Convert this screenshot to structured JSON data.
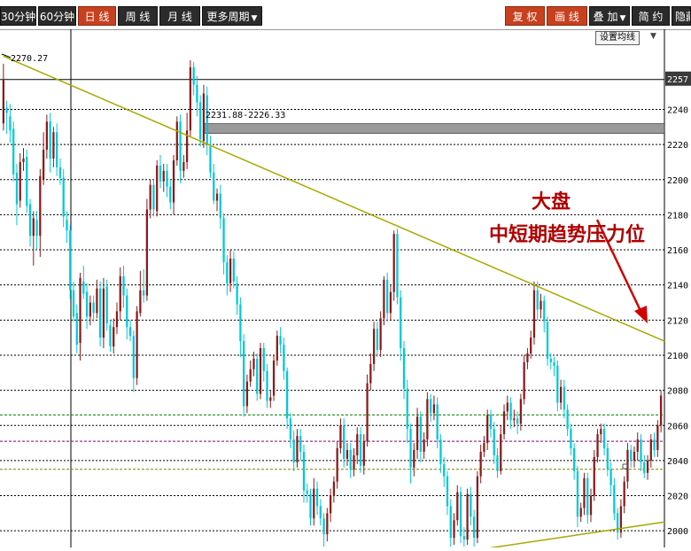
{
  "toolbar": {
    "period_tabs": [
      "30分钟",
      "60分钟",
      "日 线",
      "周 线",
      "月 线"
    ],
    "more_periods": "更多周期",
    "restore_rights": "复 权",
    "draw_line": "画 线",
    "overlay": "叠 加",
    "simple": "简 约",
    "hide": "隐藏"
  },
  "settings_button": "设置均线",
  "annotation": {
    "line1": "大盘",
    "line2": "中短期趋势压力位"
  },
  "labels": {
    "high_marker": "2270.27",
    "band_label": "2231.88-2226.33",
    "current_price_tag": "2257"
  },
  "colors": {
    "up_candle": "#8b1a1a",
    "down_candle": "#00c8d8",
    "trendline": "#a8a800",
    "annotation": "#b00000",
    "active_tab": "#c8401e"
  },
  "chart_data": {
    "type": "candlestick",
    "ylim": [
      1990,
      2270
    ],
    "y_ticks": [
      2000,
      2020,
      2040,
      2060,
      2080,
      2100,
      2120,
      2140,
      2160,
      2180,
      2200,
      2220,
      2240
    ],
    "y_tick_labels": [
      "2000",
      "2020",
      "2040",
      "2060",
      "2080",
      "2100",
      "2120",
      "2140",
      "2160",
      "2180",
      "2200",
      "2220",
      "2240"
    ],
    "horizontal_lines": [
      {
        "value": 2257,
        "color": "#000000",
        "style": "solid"
      },
      {
        "value": 2231.88,
        "color": "#808080",
        "style": "band",
        "to": 2226.33
      },
      {
        "value": 2066,
        "color": "#008000",
        "style": "dashed"
      },
      {
        "value": 2051,
        "color": "#800080",
        "style": "dashed"
      },
      {
        "value": 2035,
        "color": "#808000",
        "style": "dashed"
      }
    ],
    "resistance_trendline": {
      "from": [
        0,
        2270.27
      ],
      "to": [
        199,
        2108
      ]
    },
    "support_trendline": {
      "from": [
        145,
        1990
      ],
      "to": [
        199,
        2005
      ]
    },
    "candles": [
      [
        2232,
        2257,
        2266,
        2228
      ],
      [
        2241,
        2238,
        2245,
        2226
      ],
      [
        2236,
        2228,
        2243,
        2221
      ],
      [
        2229,
        2203,
        2233,
        2199
      ],
      [
        2204,
        2186,
        2209,
        2174
      ],
      [
        2188,
        2210,
        2215,
        2184
      ],
      [
        2210,
        2212,
        2218,
        2205
      ],
      [
        2213,
        2185,
        2217,
        2181
      ],
      [
        2186,
        2168,
        2189,
        2162
      ],
      [
        2168,
        2178,
        2182,
        2151
      ],
      [
        2177,
        2168,
        2182,
        2160
      ],
      [
        2168,
        2202,
        2206,
        2156
      ],
      [
        2200,
        2217,
        2227,
        2197
      ],
      [
        2217,
        2233,
        2237,
        2212
      ],
      [
        2233,
        2212,
        2238,
        2204
      ],
      [
        2212,
        2227,
        2230,
        2207
      ],
      [
        2227,
        2207,
        2232,
        2202
      ],
      [
        2207,
        2201,
        2212,
        2197
      ],
      [
        2201,
        2179,
        2206,
        2173
      ],
      [
        2177,
        2171,
        2182,
        2164
      ],
      [
        2171,
        2137,
        2174,
        2132
      ],
      [
        2137,
        2122,
        2142,
        2119
      ],
      [
        2124,
        2106,
        2129,
        2101
      ],
      [
        2107,
        2144,
        2147,
        2097
      ],
      [
        2142,
        2135,
        2151,
        2132
      ],
      [
        2136,
        2122,
        2141,
        2115
      ],
      [
        2122,
        2130,
        2134,
        2117
      ],
      [
        2130,
        2124,
        2134,
        2119
      ],
      [
        2124,
        2138,
        2143,
        2121
      ],
      [
        2138,
        2110,
        2142,
        2105
      ],
      [
        2110,
        2138,
        2144,
        2104
      ],
      [
        2139,
        2118,
        2143,
        2114
      ],
      [
        2117,
        2105,
        2120,
        2102
      ],
      [
        2105,
        2116,
        2121,
        2101
      ],
      [
        2116,
        2125,
        2130,
        2112
      ],
      [
        2125,
        2145,
        2150,
        2120
      ],
      [
        2145,
        2134,
        2151,
        2127
      ],
      [
        2134,
        2116,
        2138,
        2109
      ],
      [
        2116,
        2111,
        2120,
        2108
      ],
      [
        2111,
        2087,
        2114,
        2079
      ],
      [
        2087,
        2125,
        2128,
        2083
      ],
      [
        2124,
        2137,
        2148,
        2122
      ],
      [
        2137,
        2134,
        2149,
        2130
      ],
      [
        2134,
        2183,
        2189,
        2131
      ],
      [
        2183,
        2197,
        2200,
        2178
      ],
      [
        2197,
        2183,
        2200,
        2179
      ],
      [
        2182,
        2208,
        2211,
        2179
      ],
      [
        2208,
        2199,
        2214,
        2195
      ],
      [
        2199,
        2205,
        2209,
        2193
      ],
      [
        2205,
        2196,
        2209,
        2190
      ],
      [
        2196,
        2187,
        2200,
        2183
      ],
      [
        2187,
        2211,
        2214,
        2180
      ],
      [
        2211,
        2233,
        2236,
        2208
      ],
      [
        2233,
        2205,
        2237,
        2198
      ],
      [
        2205,
        2210,
        2214,
        2201
      ],
      [
        2210,
        2228,
        2238,
        2206
      ],
      [
        2228,
        2264,
        2268,
        2224
      ],
      [
        2264,
        2254,
        2267,
        2248
      ],
      [
        2254,
        2244,
        2259,
        2236
      ],
      [
        2244,
        2223,
        2248,
        2219
      ],
      [
        2222,
        2249,
        2254,
        2218
      ],
      [
        2248,
        2220,
        2253,
        2214
      ],
      [
        2219,
        2204,
        2225,
        2201
      ],
      [
        2204,
        2188,
        2209,
        2186
      ],
      [
        2188,
        2192,
        2195,
        2182
      ],
      [
        2192,
        2178,
        2197,
        2172
      ],
      [
        2178,
        2153,
        2181,
        2146
      ],
      [
        2153,
        2141,
        2157,
        2134
      ],
      [
        2141,
        2155,
        2160,
        2136
      ],
      [
        2155,
        2142,
        2159,
        2138
      ],
      [
        2141,
        2129,
        2145,
        2123
      ],
      [
        2129,
        2108,
        2133,
        2099
      ],
      [
        2108,
        2071,
        2112,
        2065
      ],
      [
        2071,
        2085,
        2089,
        2067
      ],
      [
        2085,
        2092,
        2097,
        2082
      ],
      [
        2092,
        2098,
        2102,
        2088
      ],
      [
        2098,
        2078,
        2101,
        2074
      ],
      [
        2078,
        2104,
        2107,
        2075
      ],
      [
        2104,
        2091,
        2107,
        2085
      ],
      [
        2091,
        2074,
        2095,
        2070
      ],
      [
        2074,
        2076,
        2080,
        2070
      ],
      [
        2077,
        2097,
        2100,
        2074
      ],
      [
        2097,
        2111,
        2114,
        2094
      ],
      [
        2111,
        2106,
        2116,
        2101
      ],
      [
        2106,
        2091,
        2110,
        2086
      ],
      [
        2091,
        2064,
        2093,
        2058
      ],
      [
        2064,
        2052,
        2067,
        2047
      ],
      [
        2052,
        2039,
        2057,
        2034
      ],
      [
        2039,
        2054,
        2058,
        2036
      ],
      [
        2054,
        2045,
        2058,
        2040
      ],
      [
        2045,
        2023,
        2049,
        2016
      ],
      [
        2023,
        2021,
        2027,
        2016
      ],
      [
        2021,
        2007,
        2024,
        2003
      ],
      [
        2007,
        2024,
        2030,
        2003
      ],
      [
        2024,
        2014,
        2028,
        2009
      ],
      [
        2014,
        2007,
        2018,
        2003
      ],
      [
        2007,
        1998,
        2010,
        1991
      ],
      [
        1998,
        2010,
        2013,
        1994
      ],
      [
        2010,
        2020,
        2024,
        2005
      ],
      [
        2020,
        2028,
        2031,
        2016
      ],
      [
        2028,
        2047,
        2051,
        2024
      ],
      [
        2047,
        2060,
        2064,
        2044
      ],
      [
        2060,
        2041,
        2064,
        2036
      ],
      [
        2041,
        2046,
        2050,
        2037
      ],
      [
        2046,
        2035,
        2050,
        2030
      ],
      [
        2035,
        2043,
        2047,
        2031
      ],
      [
        2043,
        2055,
        2059,
        2038
      ],
      [
        2055,
        2037,
        2059,
        2033
      ],
      [
        2037,
        2051,
        2055,
        2032
      ],
      [
        2051,
        2084,
        2089,
        2048
      ],
      [
        2084,
        2095,
        2101,
        2080
      ],
      [
        2095,
        2115,
        2119,
        2091
      ],
      [
        2115,
        2103,
        2119,
        2099
      ],
      [
        2103,
        2121,
        2125,
        2099
      ],
      [
        2121,
        2143,
        2145,
        2117
      ],
      [
        2143,
        2124,
        2147,
        2119
      ],
      [
        2124,
        2136,
        2140,
        2120
      ],
      [
        2136,
        2169,
        2171,
        2131
      ],
      [
        2169,
        2133,
        2172,
        2129
      ],
      [
        2133,
        2104,
        2137,
        2097
      ],
      [
        2104,
        2081,
        2108,
        2075
      ],
      [
        2081,
        2058,
        2086,
        2050
      ],
      [
        2058,
        2036,
        2061,
        2027
      ],
      [
        2036,
        2046,
        2050,
        2031
      ],
      [
        2046,
        2065,
        2070,
        2041
      ],
      [
        2065,
        2045,
        2068,
        2039
      ],
      [
        2045,
        2052,
        2056,
        2041
      ],
      [
        2052,
        2075,
        2079,
        2048
      ],
      [
        2075,
        2067,
        2078,
        2062
      ],
      [
        2067,
        2072,
        2077,
        2063
      ],
      [
        2072,
        2052,
        2076,
        2047
      ],
      [
        2052,
        2038,
        2055,
        2033
      ],
      [
        2038,
        2031,
        2042,
        2025
      ],
      [
        2031,
        2014,
        2034,
        2009
      ],
      [
        2014,
        1996,
        2018,
        1991
      ],
      [
        1996,
        2006,
        2010,
        1992
      ],
      [
        2006,
        2022,
        2026,
        2003
      ],
      [
        2022,
        1997,
        2025,
        1993
      ],
      [
        1997,
        1995,
        2002,
        1991
      ],
      [
        1995,
        2021,
        2024,
        1992
      ],
      [
        2021,
        2008,
        2025,
        2003
      ],
      [
        2008,
        1996,
        2012,
        1991
      ],
      [
        1996,
        2031,
        2034,
        1993
      ],
      [
        2031,
        2045,
        2049,
        2027
      ],
      [
        2045,
        2050,
        2054,
        2042
      ],
      [
        2050,
        2066,
        2069,
        2046
      ],
      [
        2066,
        2058,
        2069,
        2053
      ],
      [
        2058,
        2043,
        2062,
        2038
      ],
      [
        2043,
        2034,
        2047,
        2030
      ],
      [
        2034,
        2055,
        2060,
        2032
      ],
      [
        2055,
        2068,
        2072,
        2052
      ],
      [
        2068,
        2073,
        2077,
        2063
      ],
      [
        2073,
        2063,
        2076,
        2058
      ],
      [
        2063,
        2064,
        2069,
        2059
      ],
      [
        2064,
        2061,
        2068,
        2055
      ],
      [
        2061,
        2075,
        2078,
        2057
      ],
      [
        2075,
        2096,
        2100,
        2072
      ],
      [
        2096,
        2101,
        2104,
        2092
      ],
      [
        2101,
        2110,
        2114,
        2098
      ],
      [
        2110,
        2137,
        2142,
        2106
      ],
      [
        2137,
        2126,
        2142,
        2120
      ],
      [
        2126,
        2131,
        2135,
        2121
      ],
      [
        2131,
        2119,
        2134,
        2113
      ],
      [
        2119,
        2098,
        2122,
        2094
      ],
      [
        2098,
        2096,
        2101,
        2092
      ],
      [
        2096,
        2094,
        2099,
        2088
      ],
      [
        2094,
        2073,
        2097,
        2068
      ],
      [
        2073,
        2082,
        2086,
        2069
      ],
      [
        2082,
        2069,
        2086,
        2064
      ],
      [
        2069,
        2058,
        2072,
        2054
      ],
      [
        2058,
        2047,
        2061,
        2043
      ],
      [
        2047,
        2034,
        2050,
        2029
      ],
      [
        2034,
        2008,
        2037,
        2002
      ],
      [
        2008,
        2013,
        2016,
        2005
      ],
      [
        2013,
        2030,
        2033,
        2009
      ],
      [
        2030,
        2009,
        2033,
        2004
      ],
      [
        2009,
        2020,
        2024,
        2005
      ],
      [
        2020,
        2042,
        2046,
        2017
      ],
      [
        2042,
        2055,
        2058,
        2039
      ],
      [
        2055,
        2058,
        2061,
        2050
      ],
      [
        2058,
        2047,
        2061,
        2043
      ],
      [
        2047,
        2035,
        2050,
        2031
      ],
      [
        2035,
        2026,
        2039,
        2020
      ],
      [
        2026,
        2010,
        2030,
        2006
      ],
      [
        2010,
        1999,
        2013,
        1995
      ],
      [
        1999,
        2014,
        2018,
        1996
      ],
      [
        2014,
        2028,
        2031,
        2010
      ],
      [
        2028,
        2046,
        2050,
        2024
      ],
      [
        2046,
        2040,
        2049,
        2036
      ],
      [
        2040,
        2045,
        2048,
        2036
      ],
      [
        2045,
        2052,
        2056,
        2040
      ],
      [
        2052,
        2039,
        2055,
        2034
      ],
      [
        2039,
        2033,
        2043,
        2030
      ],
      [
        2033,
        2040,
        2043,
        2029
      ],
      [
        2040,
        2052,
        2055,
        2036
      ],
      [
        2052,
        2046,
        2056,
        2042
      ],
      [
        2046,
        2060,
        2063,
        2042
      ],
      [
        2060,
        2077,
        2080,
        2056
      ]
    ]
  }
}
